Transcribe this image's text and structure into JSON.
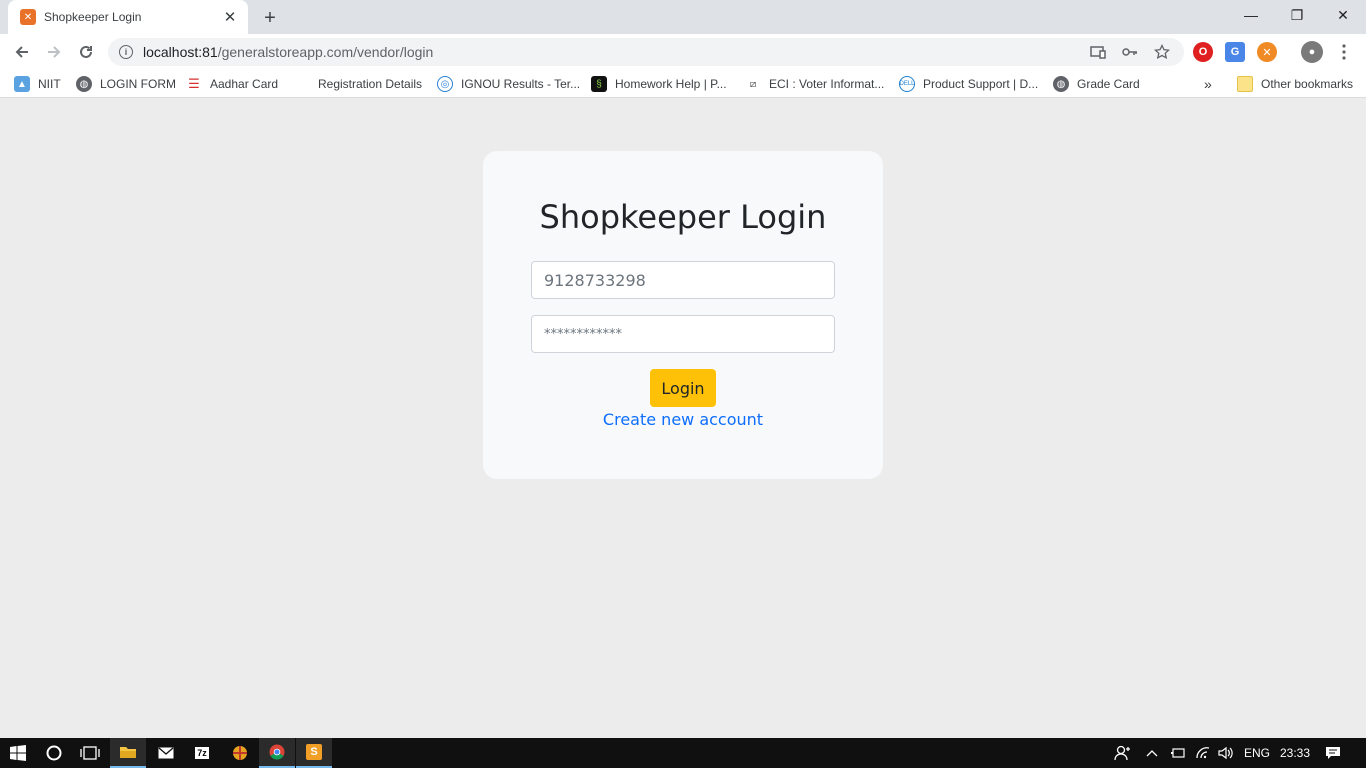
{
  "browser": {
    "tab_title": "Shopkeeper Login",
    "tab_close": "✕",
    "new_tab": "+",
    "url_host": "localhost:81",
    "url_path": "/generalstoreapp.com/vendor/login",
    "window_controls": {
      "minimize": "—",
      "maximize": "❐",
      "close": "✕"
    }
  },
  "bookmarks": {
    "items": [
      {
        "label": "NIIT",
        "icon": "niit-icon"
      },
      {
        "label": "LOGIN FORM",
        "icon": "globe-icon"
      },
      {
        "label": "Aadhar Card",
        "icon": "fingerprint-icon"
      },
      {
        "label": "Registration Details",
        "icon": "blank-icon"
      },
      {
        "label": "IGNOU Results - Ter...",
        "icon": "ignou-icon"
      },
      {
        "label": "Homework Help | P...",
        "icon": "homework-icon"
      },
      {
        "label": "ECI : Voter Informat...",
        "icon": "eci-icon"
      },
      {
        "label": "Product Support | D...",
        "icon": "dell-icon"
      },
      {
        "label": "Grade Card",
        "icon": "globe-icon"
      }
    ],
    "overflow": "»",
    "other": "Other bookmarks"
  },
  "login": {
    "title": "Shopkeeper Login",
    "phone_value": "9128733298",
    "password_value": "************",
    "button_label": "Login",
    "create_link": "Create new account"
  },
  "taskbar": {
    "lang": "ENG",
    "time": "23:33"
  },
  "colors": {
    "accent": "#ffc107",
    "link": "#0d6efd",
    "page_bg": "#ececec",
    "card_bg": "#f8f9fa"
  }
}
